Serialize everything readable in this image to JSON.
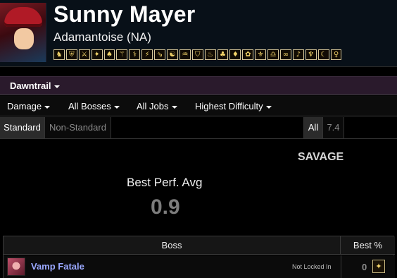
{
  "character": {
    "name": "Sunny Mayer",
    "server": "Adamantoise (NA)",
    "job_icons": [
      "♞",
      "⛨",
      "⚔",
      "✦",
      "♠",
      "⚚",
      "⚕",
      "⚡",
      "⇘",
      "☯",
      "♒",
      "⛉",
      "♨",
      "♣",
      "♦",
      "✿",
      "⚜",
      "♎",
      "∞",
      "♪",
      "♆",
      "☾",
      "♀"
    ]
  },
  "expansion": {
    "label": "Dawntrail"
  },
  "filters": [
    {
      "label": "Damage"
    },
    {
      "label": "All Bosses"
    },
    {
      "label": "All Jobs"
    },
    {
      "label": "Highest Difficulty"
    }
  ],
  "partitions": {
    "left": [
      {
        "label": "Standard",
        "active": true
      },
      {
        "label": "Non-Standard",
        "active": false
      }
    ],
    "right": [
      {
        "label": "All",
        "active": true
      },
      {
        "label": "7.4",
        "active": false
      }
    ]
  },
  "summary": {
    "difficulty": "SAVAGE",
    "perf_label": "Best Perf. Avg",
    "perf_value": "0.9"
  },
  "table": {
    "headers": {
      "boss": "Boss",
      "best": "Best %"
    },
    "rows": [
      {
        "boss": "Vamp Fatale",
        "status": "Not Locked In",
        "best": "0",
        "job_icon": "✦"
      }
    ]
  },
  "colors": {
    "header_bg": "#081018",
    "expansion_bg": "#2a1a2c",
    "boss_link": "#9aa8ff",
    "job_icon_gold": "#f4d46a",
    "perf_value": "#7c7c7c"
  }
}
